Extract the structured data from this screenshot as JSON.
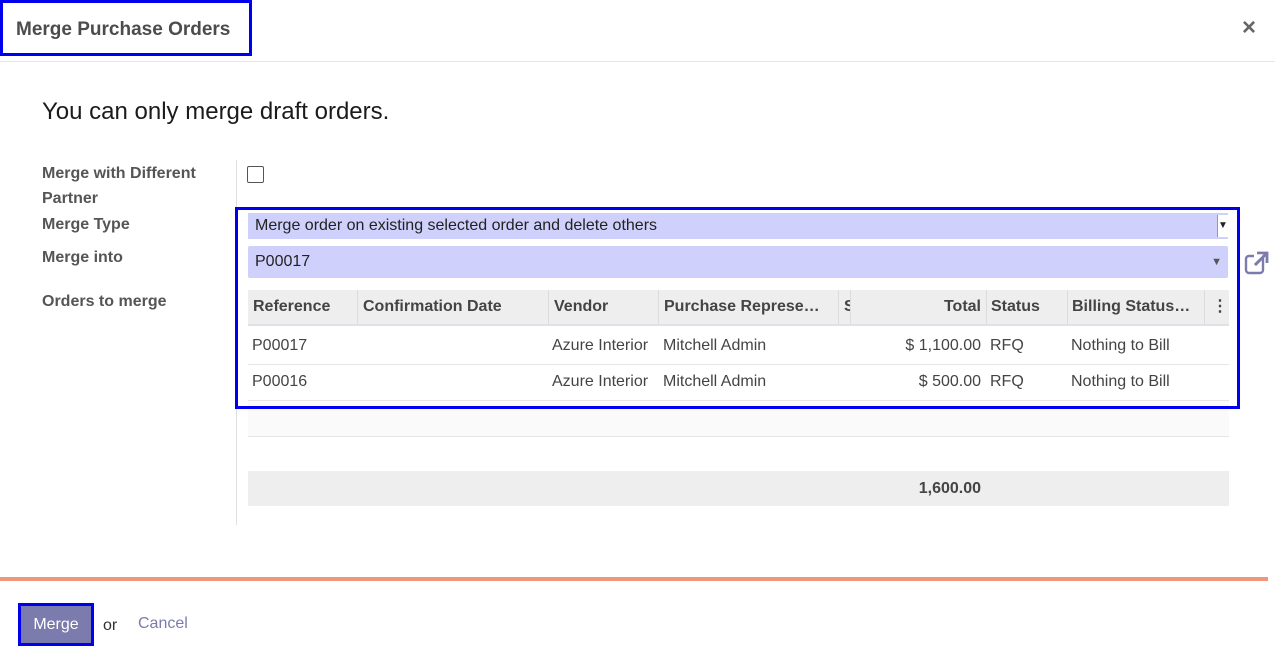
{
  "dialog": {
    "title": "Merge Purchase Orders",
    "close_icon": "×"
  },
  "warning": "You can only merge draft orders.",
  "form": {
    "merge_diff_partner_label_line1": "Merge with Different",
    "merge_diff_partner_label_line2": "Partner",
    "merge_diff_partner_checked": false,
    "merge_type_label": "Merge Type",
    "merge_type_value": "Merge order on existing selected order and delete others",
    "merge_into_label": "Merge into",
    "merge_into_value": "P00017",
    "orders_label": "Orders to merge"
  },
  "table": {
    "headers": [
      "Reference",
      "Confirmation Date",
      "Vendor",
      "Purchase Represe…",
      "S",
      "Total",
      "Status",
      "Billing Status…"
    ],
    "rows": [
      {
        "reference": "P00017",
        "confirmation_date": "",
        "vendor": "Azure Interior",
        "rep": "Mitchell Admin",
        "total": "$ 1,100.00",
        "status": "RFQ",
        "billing": "Nothing to Bill"
      },
      {
        "reference": "P00016",
        "confirmation_date": "",
        "vendor": "Azure Interior",
        "rep": "Mitchell Admin",
        "total": "$ 500.00",
        "status": "RFQ",
        "billing": "Nothing to Bill"
      }
    ],
    "footer_total": "1,600.00"
  },
  "footer": {
    "merge_label": "Merge",
    "or_text": "or",
    "cancel_label": "Cancel"
  },
  "colors": {
    "accent": "#7c7bad",
    "highlight_border": "#0000ee",
    "select_bg": "#cfd0fb",
    "divider_orange": "#f0967a"
  }
}
